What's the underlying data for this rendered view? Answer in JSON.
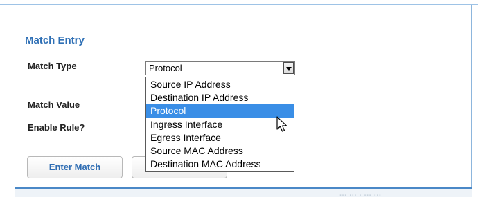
{
  "form": {
    "section_title": "Match Entry",
    "labels": {
      "match_type": "Match Type",
      "match_value": "Match Value",
      "enable_rule": "Enable Rule?"
    },
    "match_type_select": {
      "selected_value": "Protocol",
      "options": [
        "Source IP Address",
        "Destination IP Address",
        "Protocol",
        "Ingress Interface",
        "Egress Interface",
        "Source MAC Address",
        "Destination MAC Address"
      ],
      "highlighted_option": "Protocol"
    },
    "buttons": {
      "enter_match": "Enter Match",
      "second": ""
    }
  },
  "footer": {
    "ghost_text": "... ... . ... ..."
  },
  "colors": {
    "title_blue": "#2e6fb5",
    "highlight": "#3a8ee6",
    "panel_bar": "#4a88c7"
  },
  "icons": {
    "select_arrow": "chevron-down-icon",
    "cursor": "mouse-pointer-icon"
  }
}
